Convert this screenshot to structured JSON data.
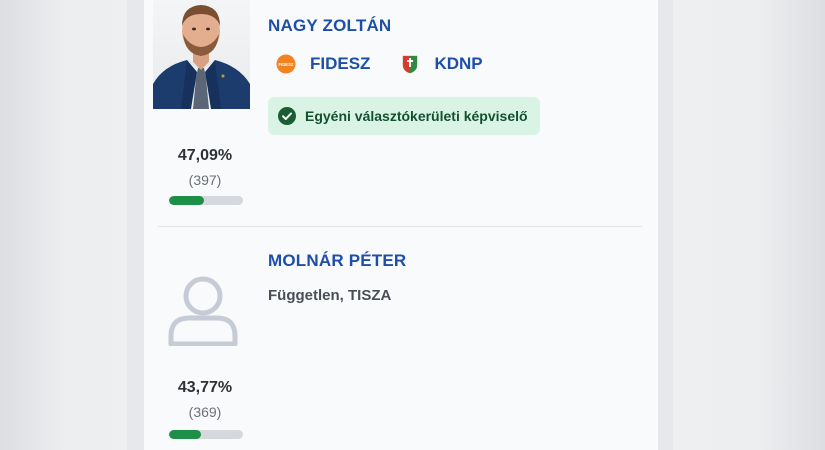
{
  "candidates": [
    {
      "name": "NAGY ZOLTÁN",
      "has_photo": true,
      "parties": [
        {
          "logo_text": "FIDESZ",
          "name": "FIDESZ",
          "logo_color": "#f58220"
        },
        {
          "logo_icon": "kdnp-shield-icon",
          "name": "KDNP",
          "logo_color": "#2f8a3e"
        }
      ],
      "badge": {
        "icon": "check-circle-icon",
        "label": "Egyéni választókerületi képviselő",
        "bg": "#d9f4e4",
        "color": "#14502f"
      },
      "percent": "47,09%",
      "votes": "(397)",
      "bar_fraction": 0.4709
    },
    {
      "name": "MOLNÁR PÉTER",
      "has_photo": false,
      "avatar_icon": "user-placeholder-icon",
      "affiliation": "Független, TISZA",
      "percent": "43,77%",
      "votes": "(369)",
      "bar_fraction": 0.4377
    }
  ],
  "colors": {
    "name": "#1e4fa8",
    "bar_fill": "#1d8f47",
    "bar_track": "#d5d9de"
  }
}
